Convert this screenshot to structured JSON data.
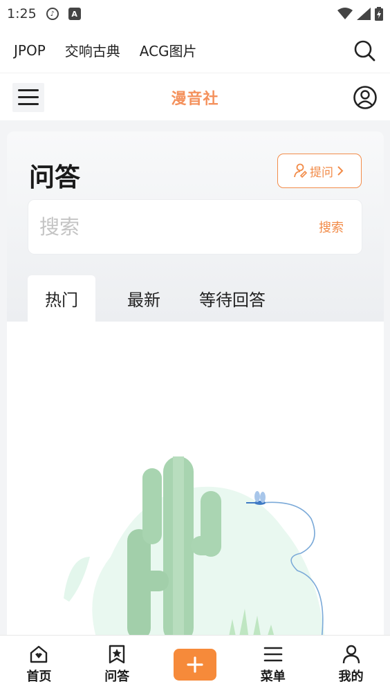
{
  "status_bar": {
    "time": "1:25",
    "icons": [
      "music-note-icon",
      "font-a-icon",
      "wifi-icon",
      "signal-icon",
      "battery-icon"
    ]
  },
  "top_nav": {
    "links": [
      "JPOP",
      "交响古典",
      "ACG图片"
    ],
    "search_icon": "search-icon"
  },
  "header": {
    "logo": "漫音社",
    "menu_icon": "hamburger-icon",
    "user_icon": "user-circle-icon"
  },
  "qa": {
    "title": "问答",
    "ask_label": "提问",
    "search_placeholder": "搜索",
    "search_button": "搜索",
    "tabs": [
      "热门",
      "最新",
      "等待回答"
    ]
  },
  "bottom_nav": {
    "items": [
      {
        "label": "首页",
        "icon": "home-icon"
      },
      {
        "label": "问答",
        "icon": "bookmark-star-icon"
      },
      {
        "label": "",
        "icon": "plus-icon"
      },
      {
        "label": "菜单",
        "icon": "menu-icon"
      },
      {
        "label": "我的",
        "icon": "person-icon"
      }
    ]
  },
  "colors": {
    "accent": "#f28b48",
    "plus_bg": "#f68a3a",
    "logo": "#f4915c"
  }
}
